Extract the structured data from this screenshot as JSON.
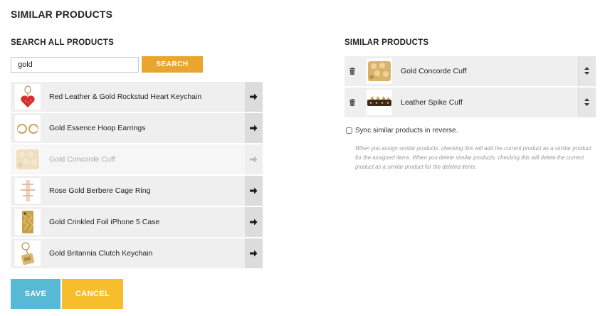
{
  "page": {
    "title": "SIMILAR PRODUCTS"
  },
  "search": {
    "heading": "SEARCH ALL PRODUCTS",
    "value": "gold",
    "button_label": "SEARCH"
  },
  "results": [
    {
      "name": "Red Leather & Gold Rockstud Heart Keychain",
      "icon": "heart-keychain",
      "added": false
    },
    {
      "name": "Gold Essence Hoop Earrings",
      "icon": "hoop-earrings",
      "added": false
    },
    {
      "name": "Gold Concorde Cuff",
      "icon": "gold-cuff",
      "added": true
    },
    {
      "name": "Rose Gold Berbere Cage Ring",
      "icon": "cage-ring",
      "added": false
    },
    {
      "name": "Gold Crinkled Foil iPhone 5 Case",
      "icon": "phone-case",
      "added": false
    },
    {
      "name": "Gold Britannia Clutch Keychain",
      "icon": "clutch-keychain",
      "added": false
    }
  ],
  "similar": {
    "heading": "SIMILAR PRODUCTS",
    "items": [
      {
        "name": "Gold Concorde Cuff",
        "icon": "gold-cuff"
      },
      {
        "name": "Leather Spike Cuff",
        "icon": "spike-cuff"
      }
    ],
    "sync_label": "Sync similar products in reverse.",
    "sync_checked": false,
    "help_text": "When you assign similar products, checking this will add the current product as a similar product for the assigned items. When you delete similar products, checking this will delete the current product as a similar product for the deleted items."
  },
  "actions": {
    "save_label": "SAVE",
    "cancel_label": "CANCEL"
  },
  "colors": {
    "search_button": "#e9a52e",
    "save_button": "#58b9d4",
    "cancel_button": "#f6bd2c",
    "row_background": "#efefef"
  },
  "icons": {
    "add": "arrow-right-icon",
    "delete": "trash-icon",
    "reorder": "sort-arrows-icon"
  }
}
